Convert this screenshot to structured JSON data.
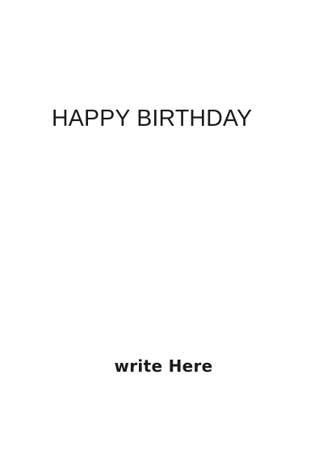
{
  "card": {
    "headline": "HAPPY BIRTHDAY",
    "write_prompt": "write Here"
  },
  "colors": {
    "background": "#ffffff",
    "text": "#1a1a1a"
  }
}
